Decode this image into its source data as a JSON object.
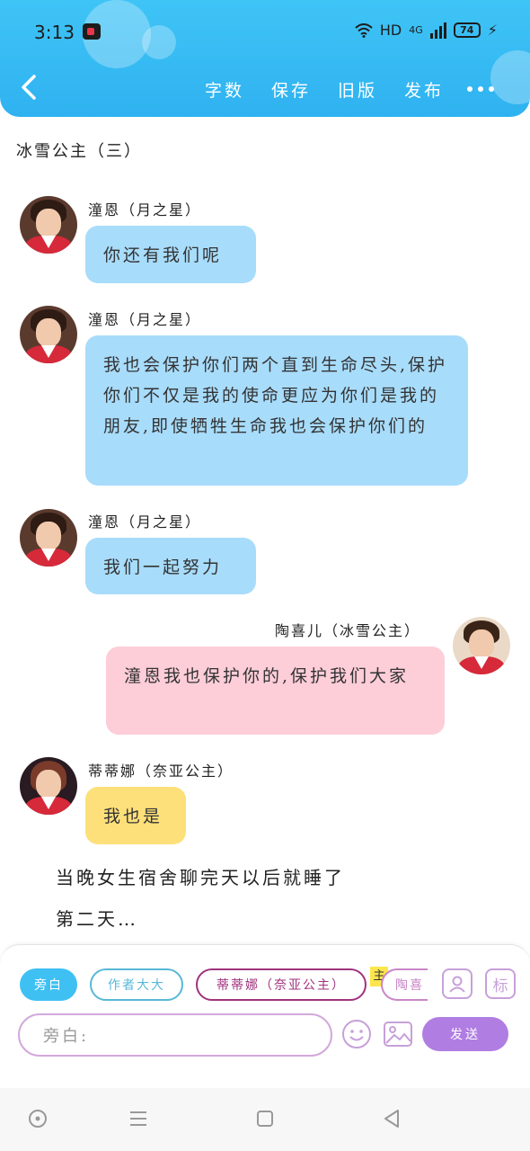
{
  "status_bar": {
    "time": "3:13",
    "network": "HD",
    "cell": "4G",
    "battery": "74"
  },
  "header": {
    "actions": [
      {
        "label": "字数"
      },
      {
        "label": "保存"
      },
      {
        "label": "旧版"
      },
      {
        "label": "发布"
      }
    ],
    "accent_color": "#3fc4f6"
  },
  "chat": {
    "title": "冰雪公主（三）",
    "messages": [
      {
        "speaker": "潼恩（月之星）",
        "text": "你还有我们呢",
        "side": "left",
        "color": "#a8dcfb"
      },
      {
        "speaker": "潼恩（月之星）",
        "text": "我也会保护你们两个直到生命尽头,保护你们不仅是我的使命更应为你们是我的朋友,即使牺牲生命我也会保护你们的",
        "side": "left",
        "color": "#a8dcfb"
      },
      {
        "speaker": "潼恩（月之星）",
        "text": "我们一起努力",
        "side": "left",
        "color": "#a8dcfb"
      },
      {
        "speaker": "陶喜儿（冰雪公主）",
        "text": "潼恩我也保护你的,保护我们大家",
        "side": "right",
        "color": "#fdcdd8"
      },
      {
        "speaker": "蒂蒂娜（奈亚公主）",
        "text": "我也是",
        "side": "left",
        "color": "#fde07a"
      }
    ],
    "narrations": [
      "当晚女生宿舍聊完天以后就睡了",
      "第二天…"
    ]
  },
  "composer": {
    "chips": [
      {
        "label": "旁白"
      },
      {
        "label": "作者大大"
      },
      {
        "label": "蒂蒂娜（奈亚公主）"
      },
      {
        "label": "陶喜"
      }
    ],
    "host_tag": "主",
    "tag_icon_label": "标",
    "input_placeholder": "旁白:",
    "send_label": "发送",
    "send_color": "#b07de2"
  }
}
